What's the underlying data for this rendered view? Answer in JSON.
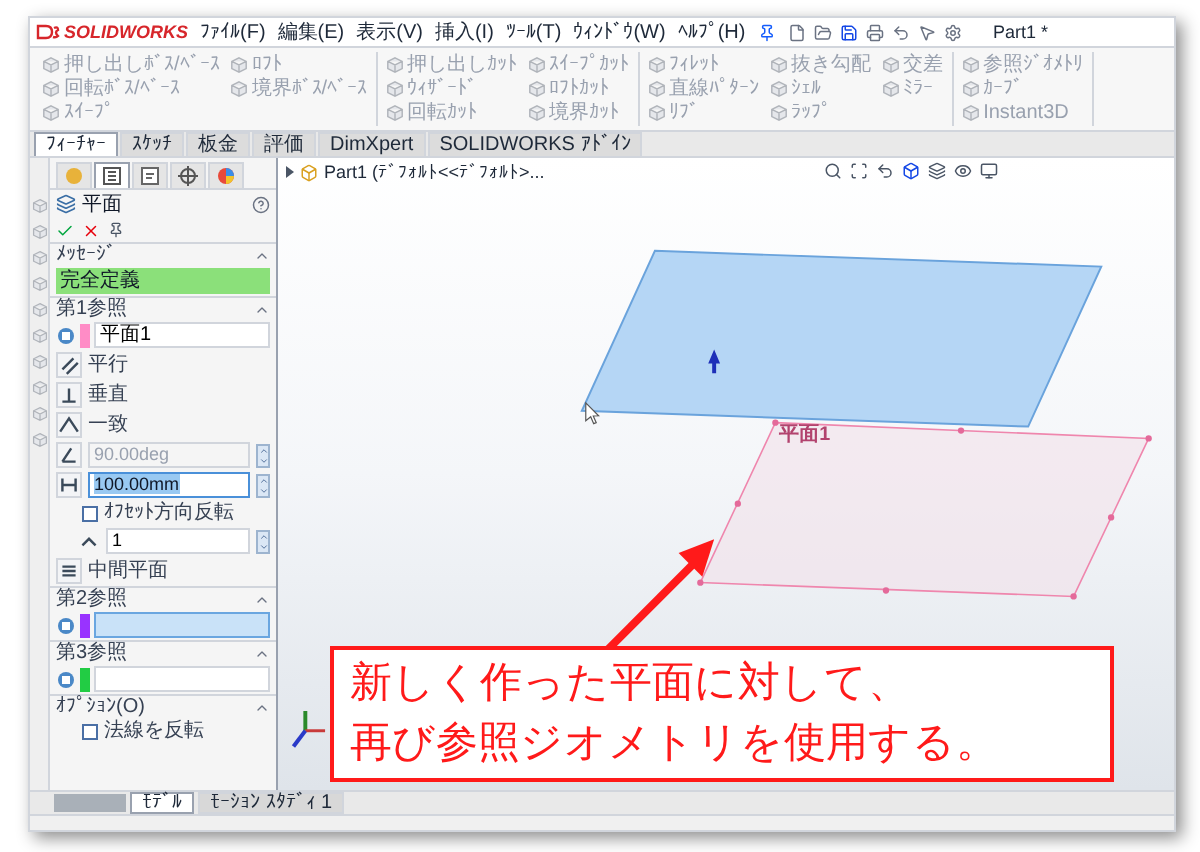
{
  "app": {
    "logo": "SOLIDWORKS",
    "title": "Part1 *"
  },
  "menu": [
    "ﾌｧｲﾙ(F)",
    "編集(E)",
    "表示(V)",
    "挿入(I)",
    "ﾂｰﾙ(T)",
    "ｳｨﾝﾄﾞｳ(W)",
    "ﾍﾙﾌﾟ(H)"
  ],
  "toolbar": [
    {
      "items": [
        {
          "label": "押し出しﾎﾞｽ/ﾍﾞｰｽ",
          "disabled": true
        },
        {
          "label": "回転ﾎﾞｽ/ﾍﾞｰｽ",
          "disabled": true
        },
        {
          "label": "ｽｲｰﾌﾟ",
          "disabled": true
        },
        {
          "label": "ﾛﾌﾄ",
          "disabled": true
        },
        {
          "label": "境界ﾎﾞｽ/ﾍﾞｰｽ",
          "disabled": true
        }
      ]
    },
    {
      "items": [
        {
          "label": "押し出しｶｯﾄ",
          "disabled": true
        },
        {
          "label": "ｳｨｻﾞｰﾄﾞ",
          "disabled": true
        },
        {
          "label": "回転ｶｯﾄ",
          "disabled": true
        },
        {
          "label": "ｽｲｰﾌﾟｶｯﾄ",
          "disabled": true
        },
        {
          "label": "ﾛﾌﾄｶｯﾄ",
          "disabled": true
        },
        {
          "label": "境界ｶｯﾄ",
          "disabled": true
        }
      ]
    },
    {
      "items": [
        {
          "label": "ﾌｨﾚｯﾄ",
          "disabled": true
        },
        {
          "label": "直線ﾊﾟﾀｰﾝ",
          "disabled": true
        },
        {
          "label": "ﾘﾌﾞ",
          "disabled": true
        },
        {
          "label": "抜き勾配",
          "disabled": true
        },
        {
          "label": "ｼｪﾙ",
          "disabled": true
        },
        {
          "label": "ﾗｯﾌﾟ",
          "disabled": true
        },
        {
          "label": "交差",
          "disabled": true
        },
        {
          "label": "ﾐﾗｰ",
          "disabled": true
        }
      ]
    },
    {
      "items": [
        {
          "label": "参照ｼﾞｵﾒﾄﾘ",
          "disabled": true
        },
        {
          "label": "ｶｰﾌﾞ",
          "disabled": true
        },
        {
          "label": "Instant3D",
          "disabled": true
        }
      ]
    }
  ],
  "command_tabs": [
    {
      "label": "ﾌｨｰﾁｬｰ",
      "selected": true
    },
    {
      "label": "ｽｹｯﾁ",
      "selected": false
    },
    {
      "label": "板金",
      "selected": false
    },
    {
      "label": "評価",
      "selected": false
    },
    {
      "label": "DimXpert",
      "selected": false
    },
    {
      "label": "SOLIDWORKS ｱﾄﾞｲﾝ",
      "selected": false
    }
  ],
  "property_manager": {
    "tabs": [
      {
        "kind": "feature_tree",
        "selected": false
      },
      {
        "kind": "property",
        "selected": true
      },
      {
        "kind": "configuration",
        "selected": false
      },
      {
        "kind": "dimxpert",
        "selected": false
      },
      {
        "kind": "display",
        "selected": false
      }
    ],
    "title": "平面",
    "sections": [
      {
        "kind": "message",
        "title": "ﾒｯｾｰｼﾞ",
        "message": "完全定義"
      },
      {
        "kind": "reference",
        "title": "第1参照",
        "color": "#ff8cc6",
        "value": "平面1",
        "active": false,
        "rows": [
          {
            "kind": "parallel",
            "label": "平行"
          },
          {
            "kind": "perpendicular",
            "label": "垂直"
          },
          {
            "kind": "coincident",
            "label": "一致"
          },
          {
            "kind": "angle",
            "value": "90.00deg",
            "disabled": true,
            "focused": false
          },
          {
            "kind": "distance",
            "value": "100.00mm",
            "disabled": false,
            "focused": true
          },
          {
            "kind": "checkbox",
            "label": "ｵﾌｾｯﾄ方向反転",
            "checked": false
          },
          {
            "kind": "count",
            "value": "1"
          },
          {
            "kind": "midplane",
            "label": "中間平面"
          }
        ]
      },
      {
        "kind": "reference",
        "title": "第2参照",
        "color": "#9933ff",
        "active": true
      },
      {
        "kind": "reference",
        "title": "第3参照",
        "color": "#22cc44",
        "active": false
      },
      {
        "kind": "options",
        "title": "ｵﾌﾟｼｮﾝ(O)",
        "options": [
          {
            "label": "法線を反転",
            "checked": false
          }
        ]
      }
    ]
  },
  "tree_flyout": "Part1 (ﾃﾞﾌｫﾙﾄ<<ﾃﾞﾌｫﾙﾄ>...",
  "viewport": {
    "plane_label": "平面1"
  },
  "callout": {
    "lines": [
      "新しく作った平面に対して、",
      "再び参照ジオメトリを使用する。"
    ]
  },
  "bottom_tabs": [
    {
      "label": "ﾓﾃﾞﾙ",
      "selected": true
    },
    {
      "label": "ﾓｰｼｮﾝ ｽﾀﾃﾞｨ 1",
      "selected": false
    }
  ]
}
